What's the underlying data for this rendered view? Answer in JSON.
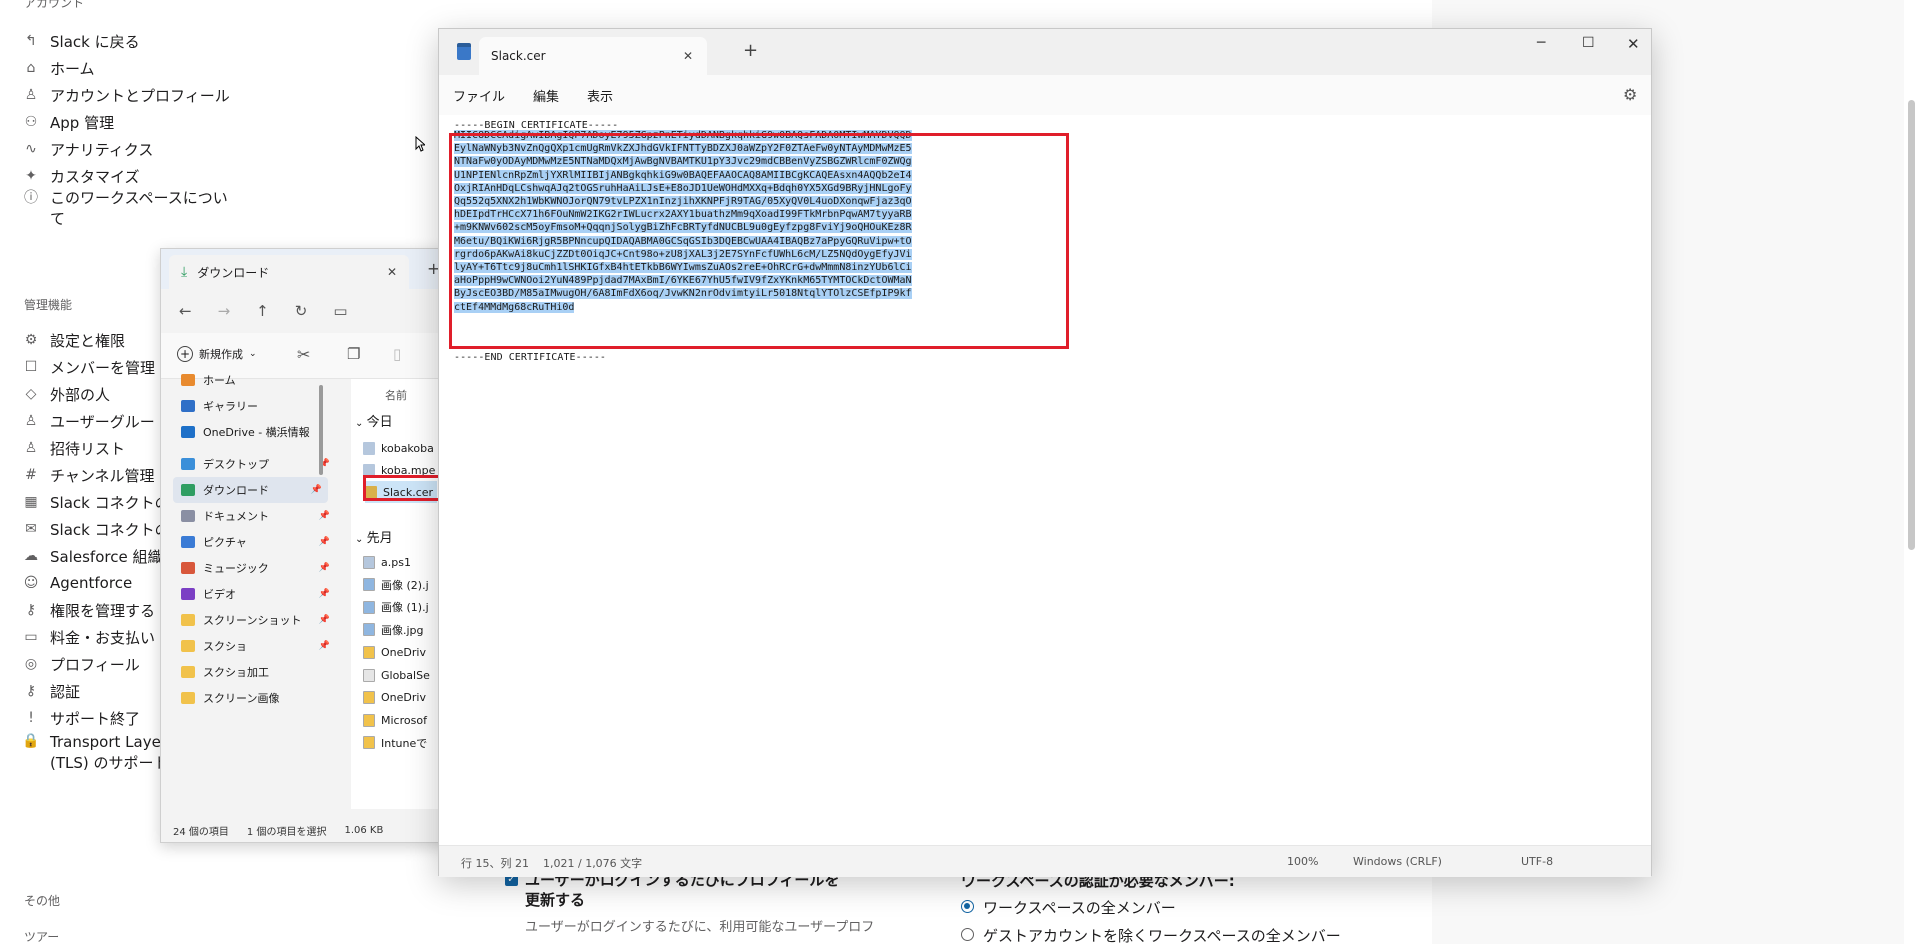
{
  "slack_sidebar": {
    "top_title": "アカウント",
    "items": [
      {
        "icon": "back-arrow-icon",
        "label": "Slack に戻る",
        "glyph": "↰"
      },
      {
        "icon": "home-icon",
        "label": "ホーム",
        "glyph": "⌂"
      },
      {
        "icon": "person-icon",
        "label": "アカウントとプロフィール",
        "glyph": "♙"
      },
      {
        "icon": "apps-icon",
        "label": "App 管理",
        "glyph": "⚇"
      },
      {
        "icon": "analytics-icon",
        "label": "アナリティクス",
        "glyph": "∿"
      },
      {
        "icon": "customize-icon",
        "label": "カスタマイズ",
        "glyph": "✦"
      },
      {
        "icon": "info-icon",
        "label": "このワークスペースについて",
        "glyph": "ⓘ"
      }
    ],
    "admin_title": "管理機能",
    "admin_items": [
      {
        "icon": "settings-icon",
        "label": "設定と権限",
        "glyph": "⚙"
      },
      {
        "icon": "member-icon",
        "label": "メンバーを管理",
        "glyph": "☐"
      },
      {
        "icon": "external-icon",
        "label": "外部の人",
        "glyph": "◇"
      },
      {
        "icon": "user-group-icon",
        "label": "ユーザーグルー",
        "glyph": "♙"
      },
      {
        "icon": "invite-icon",
        "label": "招待リスト",
        "glyph": "♙"
      },
      {
        "icon": "channel-icon",
        "label": "チャンネル管理",
        "glyph": "#"
      },
      {
        "icon": "slack-connect-icon",
        "label": "Slack コネクトの",
        "glyph": "▦"
      },
      {
        "icon": "mail-icon",
        "label": "Slack コネクトの",
        "glyph": "✉"
      },
      {
        "icon": "salesforce-icon",
        "label": "Salesforce 組織",
        "glyph": "☁"
      },
      {
        "icon": "agentforce-icon",
        "label": "Agentforce",
        "glyph": "☺"
      },
      {
        "icon": "key-icon",
        "label": "権限を管理する",
        "glyph": "⚷"
      },
      {
        "icon": "billing-icon",
        "label": "料金・お支払い",
        "glyph": "▭"
      },
      {
        "icon": "globe-icon",
        "label": "プロフィール",
        "glyph": "◎"
      },
      {
        "icon": "auth-icon",
        "label": "認証",
        "glyph": "⚷"
      },
      {
        "icon": "alert-icon",
        "label": "サポート終了",
        "glyph": "!"
      },
      {
        "icon": "lock-icon",
        "label": "Transport Layer (TLS) のサポート",
        "glyph": "🔒"
      }
    ],
    "other_title": "その他",
    "tools_title": "ツアー"
  },
  "slack_main_bottom": {
    "checkbox_label": "ユーザーがログインするたびにプロフィールを更新する",
    "checkbox_desc": "ユーザーがログインするたびに、利用可能なユーザープロフ",
    "auth_title": "ワークスペースの認証が必要なメンバー:",
    "radio_1": "ワークスペースの全メンバー",
    "radio_2": "ゲストアカウントを除くワークスペースの全メンバー"
  },
  "explorer": {
    "tab_title": "ダウンロード",
    "new_button": "新規作成",
    "column_name": "名前",
    "nav_items": [
      {
        "label": "ホーム",
        "color": "#e88a2e"
      },
      {
        "label": "ギャラリー",
        "color": "#2f6fc7"
      },
      {
        "label": "OneDrive - 横浜情報",
        "color": "#1e70c8"
      },
      {
        "label": "デスクトップ",
        "color": "#3b8fd9"
      },
      {
        "label": "ダウンロード",
        "color": "#2f9e62"
      },
      {
        "label": "ドキュメント",
        "color": "#8a8fa3"
      },
      {
        "label": "ピクチャ",
        "color": "#3a7bd5"
      },
      {
        "label": "ミュージック",
        "color": "#d8573b"
      },
      {
        "label": "ビデオ",
        "color": "#7b3fc4"
      },
      {
        "label": "スクリーンショット",
        "color": "#f1c24b"
      },
      {
        "label": "スクショ",
        "color": "#f1c24b"
      },
      {
        "label": "スクショ加工",
        "color": "#f1c24b"
      },
      {
        "label": "スクリーン画像",
        "color": "#f1c24b"
      }
    ],
    "group_today": "今日",
    "group_lastmonth": "先月",
    "files_today": [
      "kobakoba",
      "koba.mpe",
      "Slack.cer"
    ],
    "files_lastmonth": [
      "a.ps1",
      "画像 (2).j",
      "画像 (1).j",
      "画像.jpg",
      "OneDriv",
      "GlobalSe",
      "OneDriv",
      "Microsof",
      "Intuneで"
    ],
    "status_count": "24 個の項目",
    "status_selected": "1 個の項目を選択",
    "status_size": "1.06 KB"
  },
  "notepad": {
    "tab_title": "Slack.cer",
    "menu": [
      "ファイル",
      "編集",
      "表示"
    ],
    "begin_line": "-----BEGIN CERTIFICATE-----",
    "cert_lines": [
      "MIIC8DCCAdigAwIBAgIQP7ADoyE795ZGpzPnETiydDANBgkqhkiG9w0BAQsFADA0MTIwMAYDVQQD",
      "EylNaWNyb3NvZnQgQXp1cmUgRmVkZXJhdGVkIFNTTyBDZXJ0aWZpY2F0ZTAeFw0yNTAyMDMwMzE5",
      "NTNaFw0yODAyMDMwMzE5NTNaMDQxMjAwBgNVBAMTKU1pY3Jvc29mdCBBenVyZSBGZWRlcmF0ZWQg",
      "U1NPIENlcnRpZmljYXRlMIIBIjANBgkqhkiG9w0BAQEFAAOCAQ8AMIIBCgKCAQEAsxn4AQQb2eI4",
      "OxjRIAnHDqLCshwqAJq2tOGSruhHaAiLJsE+E8oJD1UeWOHdMXXq+Bdqh0YX5XGd9BRyjHNLgoFy",
      "Qq552q5XNX2h1WbKWNOJorQN79tvLPZX1nInzjihXKNPFjR9TAG/05XyQV0L4uoDXonqwFjaz3qO",
      "hDEIpdTrHCcX71h6FOuNmW2IKG2rIWLucrx2AXY1buathzMm9qXoadI99FTkMrbnPqwAM7tyyaRB",
      "+m9KNWv602scM5oyFmsoM+QqqnjSolygBiZhFcBRTyfdNUCBL9u0gEyfzpg8FviYj9oQHOuKEz8R",
      "M6etu/BQiKWi6RjgR5BPNncupQIDAQABMA0GCSqGSIb3DQEBCwUAA4IBAQBz7aPpyGQRuVipw+tO",
      "rgrdo6pAKwAi8kuCjZZDt0OiqJC+Cnt98o+zU8jXAL3j2E7SYnFcfUWhL6cM/LZ5NQdOygEfyJVi",
      "lyAY+T6Ttc9j8uCmh1lSHKIGfxB4htETkbB6WYIwmsZuAOs2reE+OhRCrG+dwMmmN8inzYUb6lCi",
      "aHoPppH9wCWNOoi2YuN489Ppjdad7MAxBmI/6YKE67YhU5fwIV9fZxYKnkM65TYMTOCkDctOWMaN",
      "ByJscEO3BD/M85aIMwugOH/6A8ImFdX6oq/JvwKN2nrOdvimtyiLr5018NtqlYTOlzCSEfpIP9kf",
      "ctEf4MMdMg68cRuTHi0d"
    ],
    "end_line": "-----END CERTIFICATE-----",
    "status": {
      "position": "行 15、列 21",
      "chars": "1,021 / 1,076 文字",
      "zoom": "100%",
      "eol": "Windows (CRLF)",
      "encoding": "UTF-8"
    }
  },
  "colors": {
    "highlight_red": "#e01e2a",
    "selection_blue": "#a9d0f5",
    "slack_blue": "#1264a3"
  }
}
